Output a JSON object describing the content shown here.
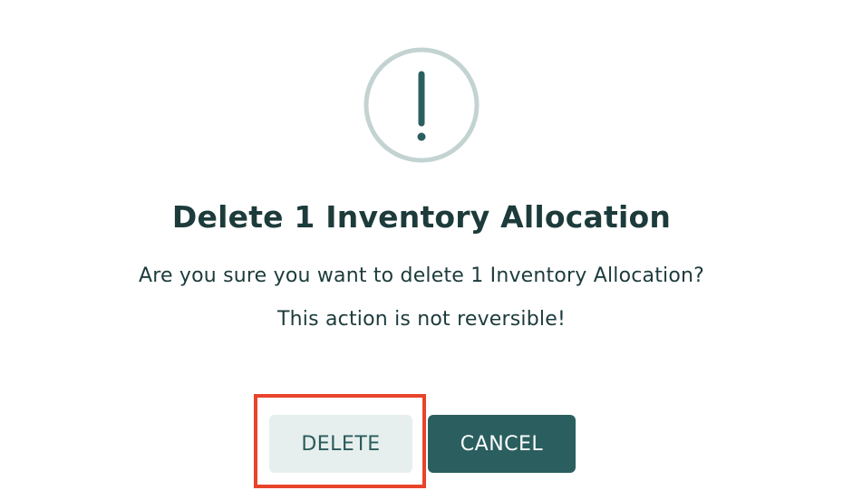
{
  "dialog": {
    "icon": "exclamation-circle-icon",
    "title": "Delete 1 Inventory Allocation",
    "message_line1": "Are you sure you want to delete 1 Inventory Allocation?",
    "message_line2": "This action is not reversible!",
    "delete_label": "DELETE",
    "cancel_label": "CANCEL"
  },
  "colors": {
    "icon_ring": "#c3d3d1",
    "icon_mark": "#2b5f5f",
    "text": "#1d3b3b",
    "delete_bg": "#e6efed",
    "delete_text": "#2b5b5b",
    "cancel_bg": "#2b5f5f",
    "cancel_text": "#ffffff",
    "highlight": "#e8442b"
  }
}
